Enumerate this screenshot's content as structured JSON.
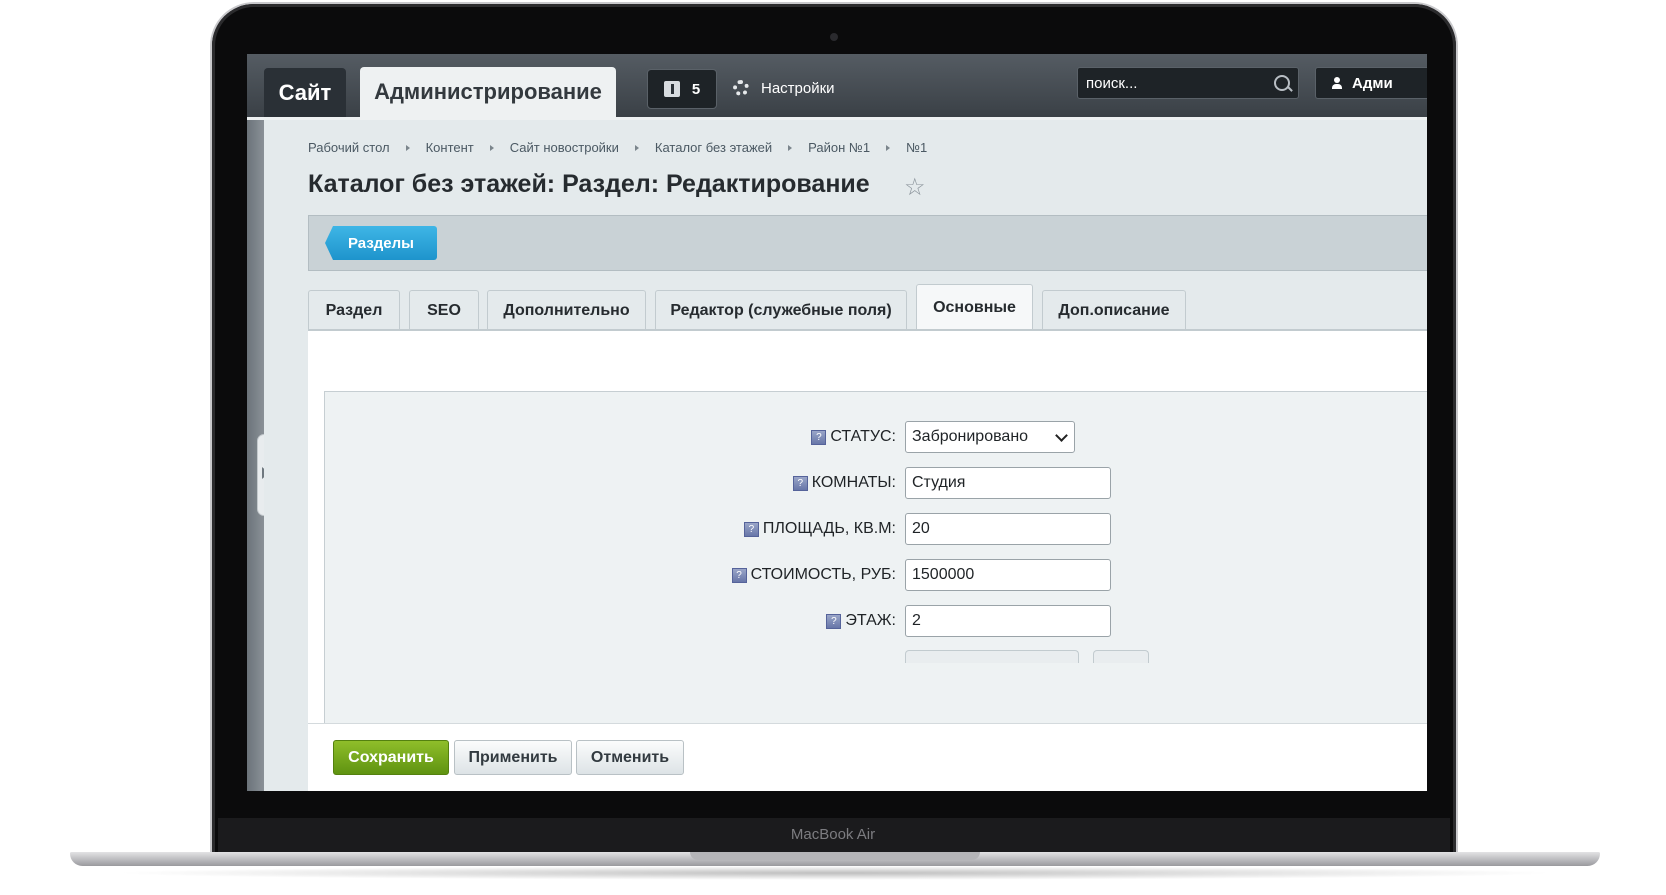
{
  "device": {
    "brand_label": "MacBook Air"
  },
  "topbar": {
    "site_label": "Сайт",
    "admin_label": "Администрирование",
    "notifications_count": "5",
    "settings_label": "Настройки",
    "search_placeholder": "поиск...",
    "user_label": "Адми"
  },
  "breadcrumb": [
    "Рабочий стол",
    "Контент",
    "Сайт новостройки",
    "Каталог без этажей",
    "Район №1",
    "№1"
  ],
  "page_title": "Каталог без этажей: Раздел: Редактирование",
  "toolbar": {
    "sections_button": "Разделы"
  },
  "tabs": [
    {
      "label": "Раздел",
      "active": false
    },
    {
      "label": "SEO",
      "active": false
    },
    {
      "label": "Дополнительно",
      "active": false
    },
    {
      "label": "Редактор (служебные поля)",
      "active": false
    },
    {
      "label": "Основные",
      "active": true
    },
    {
      "label": "Доп.описание",
      "active": false
    }
  ],
  "form": {
    "status": {
      "label": "СТАТУС:",
      "value": "Забронировано",
      "options": [
        "Забронировано"
      ]
    },
    "rooms": {
      "label": "КОМНАТЫ:",
      "value": "Студия"
    },
    "area": {
      "label": "ПЛОЩАДЬ, КВ.М:",
      "value": "20"
    },
    "price": {
      "label": "СТОИМОСТЬ, РУБ:",
      "value": "1500000"
    },
    "floor": {
      "label": "ЭТАЖ:",
      "value": "2"
    }
  },
  "footer": {
    "save_label": "Сохранить",
    "apply_label": "Применить",
    "cancel_label": "Отменить"
  },
  "colors": {
    "accent_blue": "#1e94cc",
    "save_green": "#6fa51a",
    "topbar_dark": "#3a4046"
  }
}
